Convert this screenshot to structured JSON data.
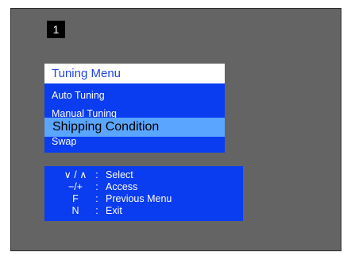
{
  "badge": {
    "number": "1"
  },
  "menu": {
    "title": "Tuning Menu",
    "items": [
      {
        "label": "Auto Tuning",
        "selected": false
      },
      {
        "label": "Manual Tuning",
        "selected": false
      },
      {
        "label": "Shipping Condition",
        "selected": true
      },
      {
        "label": "Swap",
        "selected": false
      }
    ]
  },
  "help": {
    "separator": ":",
    "rows": [
      {
        "key": "∨ / ∧",
        "action": "Select"
      },
      {
        "key": "−/+",
        "action": "Access"
      },
      {
        "key": "F",
        "action": "Previous Menu"
      },
      {
        "key": "N",
        "action": "Exit"
      }
    ]
  },
  "colors": {
    "screen_bg": "#646464",
    "menu_blue": "#0a3cf0",
    "highlight": "#5aa5ff",
    "title_text": "#1e46e6"
  }
}
